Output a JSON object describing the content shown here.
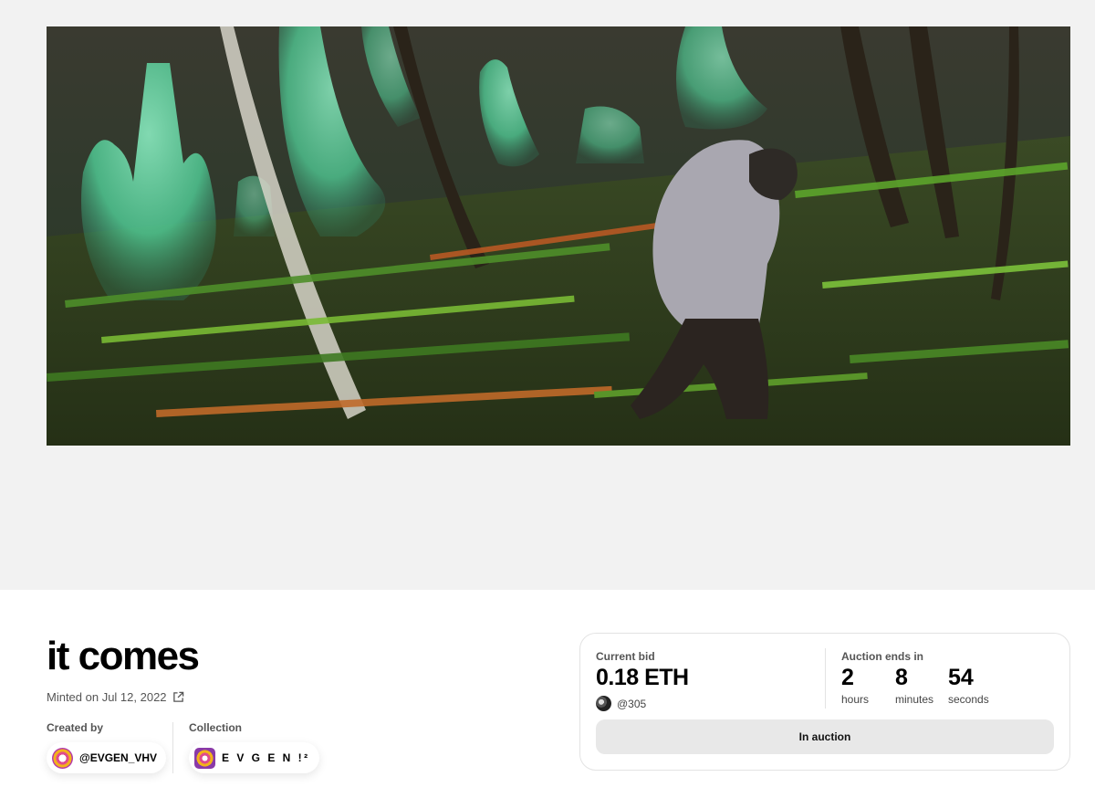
{
  "artwork": {
    "subject": "painting of a hooded figure walking through a dark forest with glowing green ghost-like shapes"
  },
  "nft": {
    "title": "it comes",
    "minted_text": "Minted on Jul 12, 2022"
  },
  "creator": {
    "label": "Created by",
    "handle": "@EVGEN_VHV"
  },
  "collection": {
    "label": "Collection",
    "name": "E V G E N !²"
  },
  "auction": {
    "bid_label": "Current bid",
    "bid_value": "0.18 ETH",
    "bidder": "@305",
    "ends_label": "Auction ends in",
    "hours": "2",
    "hours_unit": "hours",
    "minutes": "8",
    "minutes_unit": "minutes",
    "seconds": "54",
    "seconds_unit": "seconds",
    "status": "In auction"
  },
  "colors": {
    "hero_bg": "#f2f2f2",
    "ghost_green": "#5fe0a8",
    "button_bg": "#e8e8e8"
  },
  "icons": [
    "external-link-icon"
  ]
}
